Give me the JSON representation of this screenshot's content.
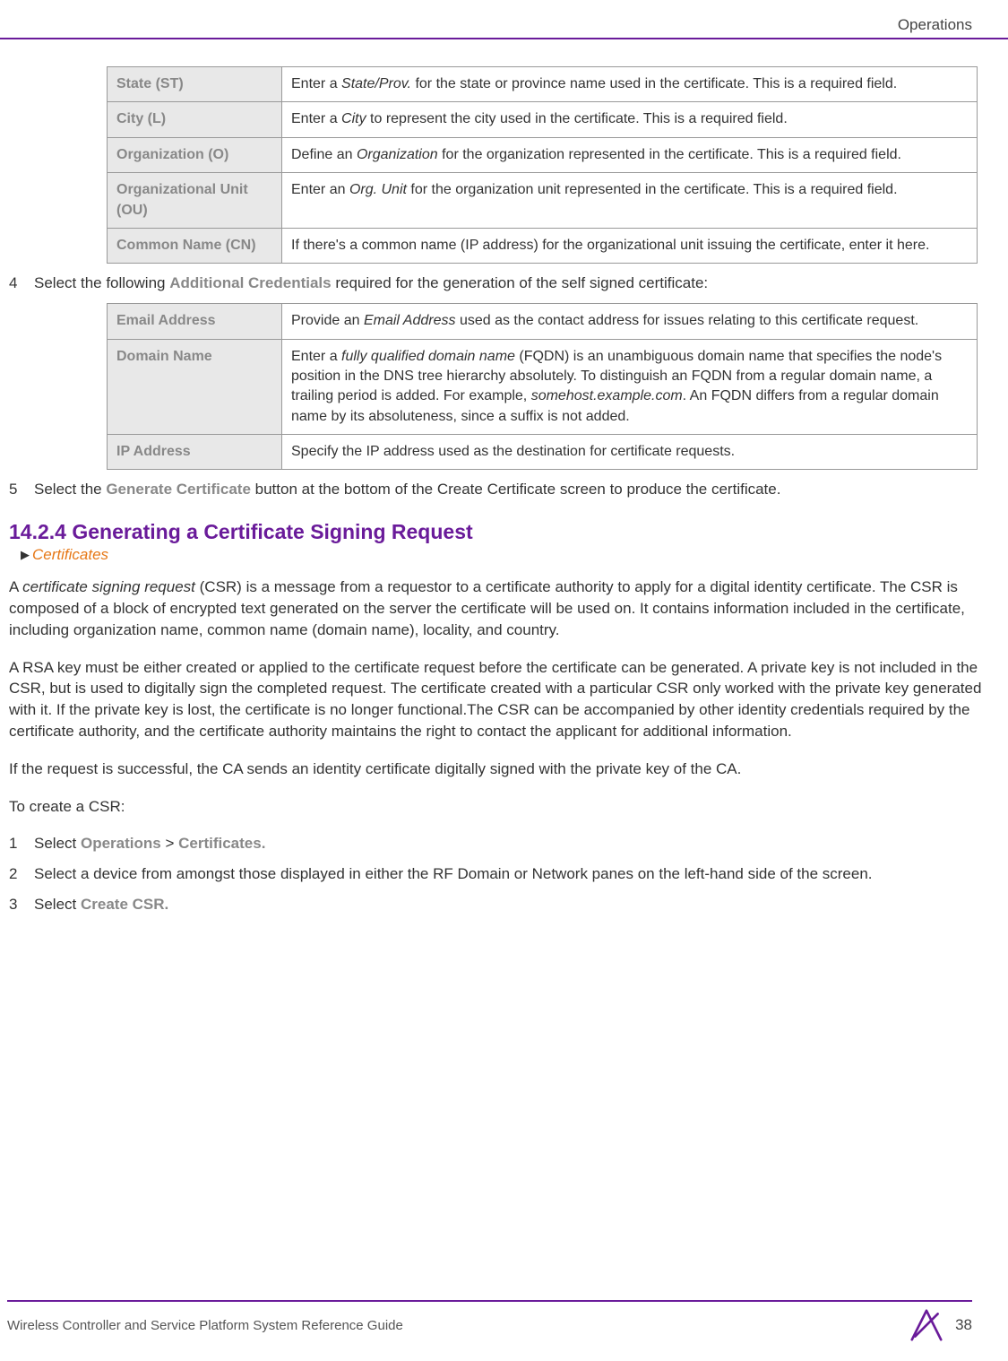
{
  "header": {
    "section": "Operations"
  },
  "table1": {
    "rows": [
      {
        "label": "State (ST)",
        "desc_parts": [
          "Enter a ",
          "State/Prov.",
          " for the state or province name used in the certificate. This is a required field."
        ]
      },
      {
        "label": "City (L)",
        "desc_parts": [
          "Enter a ",
          "City",
          " to represent the city used in the certificate. This is a required field."
        ]
      },
      {
        "label": "Organization (O)",
        "desc_parts": [
          "Define an ",
          "Organization",
          " for the organization represented in the certificate. This is a required field."
        ]
      },
      {
        "label": "Organizational Unit (OU)",
        "desc_parts": [
          "Enter an ",
          "Org. Unit",
          " for the organization unit represented in the certificate. This is a required field."
        ]
      },
      {
        "label": "Common Name (CN)",
        "desc_parts": [
          "If there's a common name (IP address) for the organizational unit issuing the certificate, enter it here.",
          "",
          ""
        ]
      }
    ]
  },
  "step4": {
    "num": "4",
    "pre": "Select the following ",
    "bold": "Additional Credentials",
    "post": " required for the generation of the self signed certificate:"
  },
  "table2": {
    "rows": [
      {
        "label": "Email Address",
        "desc_parts": [
          "Provide an ",
          "Email Address",
          " used as the contact address for issues relating to this certificate request."
        ]
      },
      {
        "label": "Domain Name",
        "desc_parts": [
          "Enter a ",
          "fully qualified domain name",
          " (FQDN) is an unambiguous domain name that specifies the node's position in the DNS tree hierarchy absolutely. To distinguish an FQDN from a regular domain name, a trailing period is added. For example, ",
          "somehost.example.com",
          ". An FQDN differs from a regular domain name by its absoluteness, since a suffix is not added."
        ]
      },
      {
        "label": "IP Address",
        "desc_parts": [
          "Specify the IP address used as the destination for certificate requests.",
          "",
          ""
        ]
      }
    ]
  },
  "step5": {
    "num": "5",
    "pre": "Select the ",
    "bold": "Generate Certificate",
    "post": " button at the bottom of the Create Certificate screen to produce the certificate."
  },
  "section": {
    "heading": "14.2.4 Generating a Certificate Signing Request",
    "breadcrumb": "Certificates"
  },
  "paragraphs": {
    "p1": {
      "pre": "A ",
      "italic": "certificate signing request",
      "post": " (CSR) is a message from a requestor to a certificate authority to apply for a digital identity certificate. The CSR is composed of a block of encrypted text generated on the server the certificate will be used on. It contains information included in the certificate, including organization name, common name (domain name), locality, and country."
    },
    "p2": "A RSA key must be either created or applied to the certificate request before the certificate can be generated. A private key is not included in the CSR, but is used to digitally sign the completed request. The certificate created with a particular CSR only worked with the private key generated with it. If the private key is lost, the certificate is no longer functional.The CSR can be accompanied by other identity credentials required by the certificate authority, and the certificate authority maintains the right to contact the applicant for additional information.",
    "p3": "If the request is successful, the CA sends an identity certificate digitally signed with the private key of the CA.",
    "p4": "To create a CSR:"
  },
  "steps_bottom": {
    "s1": {
      "num": "1",
      "pre": "Select ",
      "bold1": "Operations",
      "mid": " > ",
      "bold2": "Certificates."
    },
    "s2": {
      "num": "2",
      "text": "Select a device from amongst those displayed in either the RF Domain or Network panes on the left-hand side of the screen."
    },
    "s3": {
      "num": "3",
      "pre": "Select ",
      "bold": "Create CSR."
    }
  },
  "footer": {
    "title": "Wireless Controller and Service Platform System Reference Guide",
    "page": "38"
  }
}
